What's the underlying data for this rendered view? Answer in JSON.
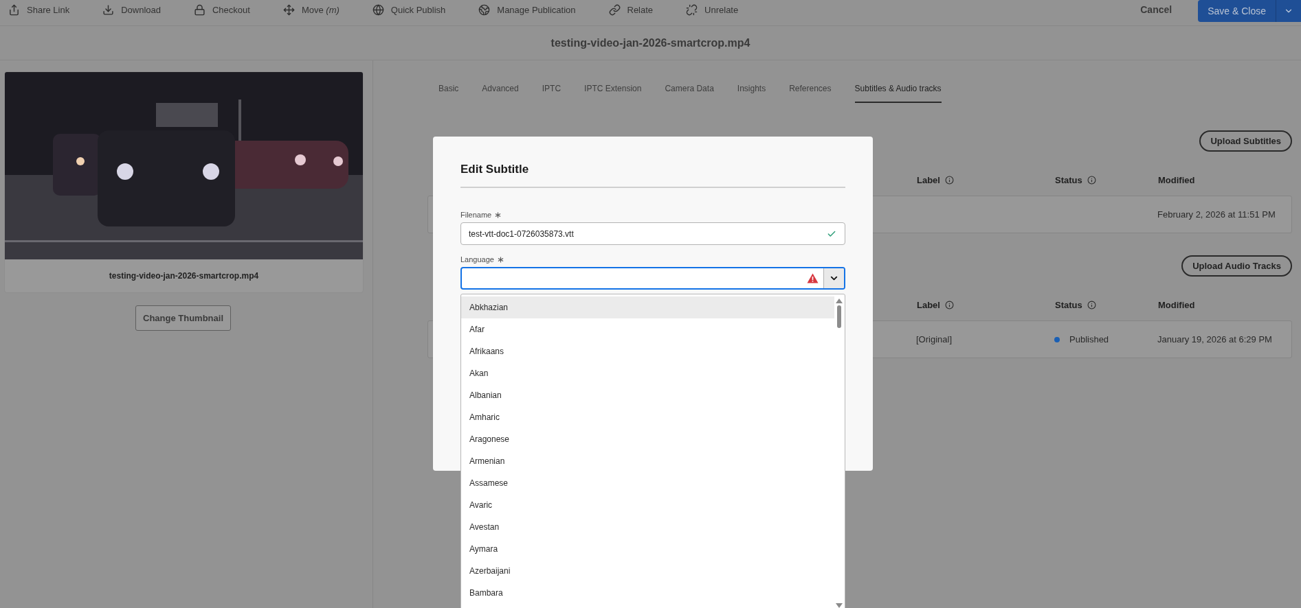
{
  "toolbar": {
    "actions": [
      {
        "label": "Share Link"
      },
      {
        "label": "Download"
      },
      {
        "label": "Checkout"
      },
      {
        "label": "Move *(m)*"
      },
      {
        "label": "Quick Publish"
      },
      {
        "label": "Manage Publication"
      },
      {
        "label": "Relate"
      },
      {
        "label": "Unrelate"
      }
    ],
    "cancel": "Cancel",
    "save": "Save & Close"
  },
  "title": "testing-video-jan-2026-smartcrop.mp4",
  "asset": {
    "caption": "testing-video-jan-2026-smartcrop.mp4",
    "change_thumbnail": "Change Thumbnail"
  },
  "tabs": [
    {
      "label": "Basic",
      "selected": false
    },
    {
      "label": "Advanced",
      "selected": false
    },
    {
      "label": "IPTC",
      "selected": false
    },
    {
      "label": "IPTC Extension",
      "selected": false
    },
    {
      "label": "Camera Data",
      "selected": false
    },
    {
      "label": "Insights",
      "selected": false
    },
    {
      "label": "References",
      "selected": false
    },
    {
      "label": "Subtitles & Audio tracks",
      "selected": true
    }
  ],
  "sections": [
    {
      "upload": "Upload Subtitles",
      "columns": [
        {
          "label": "Label",
          "info": true
        },
        {
          "label": "Status",
          "info": true
        },
        {
          "label": "Modified",
          "info": false
        }
      ],
      "rows": [
        {
          "modified": "February 2, 2026 at 11:51 PM"
        }
      ]
    },
    {
      "upload": "Upload Audio Tracks",
      "columns": [
        {
          "label": "Label",
          "info": true
        },
        {
          "label": "Status",
          "info": true
        },
        {
          "label": "Modified",
          "info": false
        }
      ],
      "rows": [
        {
          "label": "[Original]",
          "status": "Published",
          "color": "#1a5fb4",
          "modified": "January 19, 2026 at 6:29 PM"
        }
      ]
    }
  ],
  "dialog": {
    "title": "Edit Subtitle",
    "fields": [
      {
        "kind": "text",
        "label": "Filename",
        "required": true,
        "value": "test-vtt-doc1-0726035873.vtt",
        "valid": true,
        "focused": false
      },
      {
        "kind": "select",
        "label": "Language",
        "required": true,
        "valid": false,
        "focused": true
      }
    ],
    "options": [
      {
        "label": "Abkhazian",
        "highlighted": true
      },
      {
        "label": "Afar",
        "highlighted": false
      },
      {
        "label": "Afrikaans",
        "highlighted": false
      },
      {
        "label": "Akan",
        "highlighted": false
      },
      {
        "label": "Albanian",
        "highlighted": false
      },
      {
        "label": "Amharic",
        "highlighted": false
      },
      {
        "label": "Aragonese",
        "highlighted": false
      },
      {
        "label": "Armenian",
        "highlighted": false
      },
      {
        "label": "Assamese",
        "highlighted": false
      },
      {
        "label": "Avaric",
        "highlighted": false
      },
      {
        "label": "Avestan",
        "highlighted": false
      },
      {
        "label": "Aymara",
        "highlighted": false
      },
      {
        "label": "Azerbaijani",
        "highlighted": false
      },
      {
        "label": "Bambara",
        "highlighted": false
      }
    ]
  }
}
